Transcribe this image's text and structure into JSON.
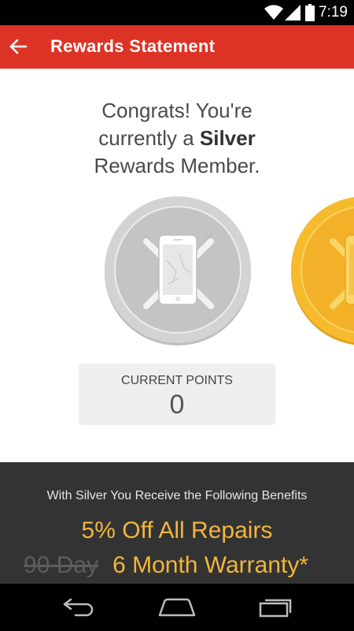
{
  "status_bar": {
    "time": "7:19"
  },
  "app_bar": {
    "title": "Rewards Statement"
  },
  "congrats": {
    "line1": "Congrats! You're",
    "line2_prefix": "currently a ",
    "tier": "Silver",
    "line3": "Rewards Member."
  },
  "points": {
    "label": "CURRENT POINTS",
    "value": "0"
  },
  "benefits": {
    "heading": "With Silver You Receive the Following Benefits",
    "items": [
      {
        "text": "5% Off All Repairs"
      },
      {
        "struck": "90 Day",
        "text": "6 Month Warranty*"
      }
    ]
  },
  "colors": {
    "appbar": "#dd3326",
    "accent": "#f2b63c",
    "silver": "#c9c9c9",
    "gold": "#f5b92c"
  }
}
